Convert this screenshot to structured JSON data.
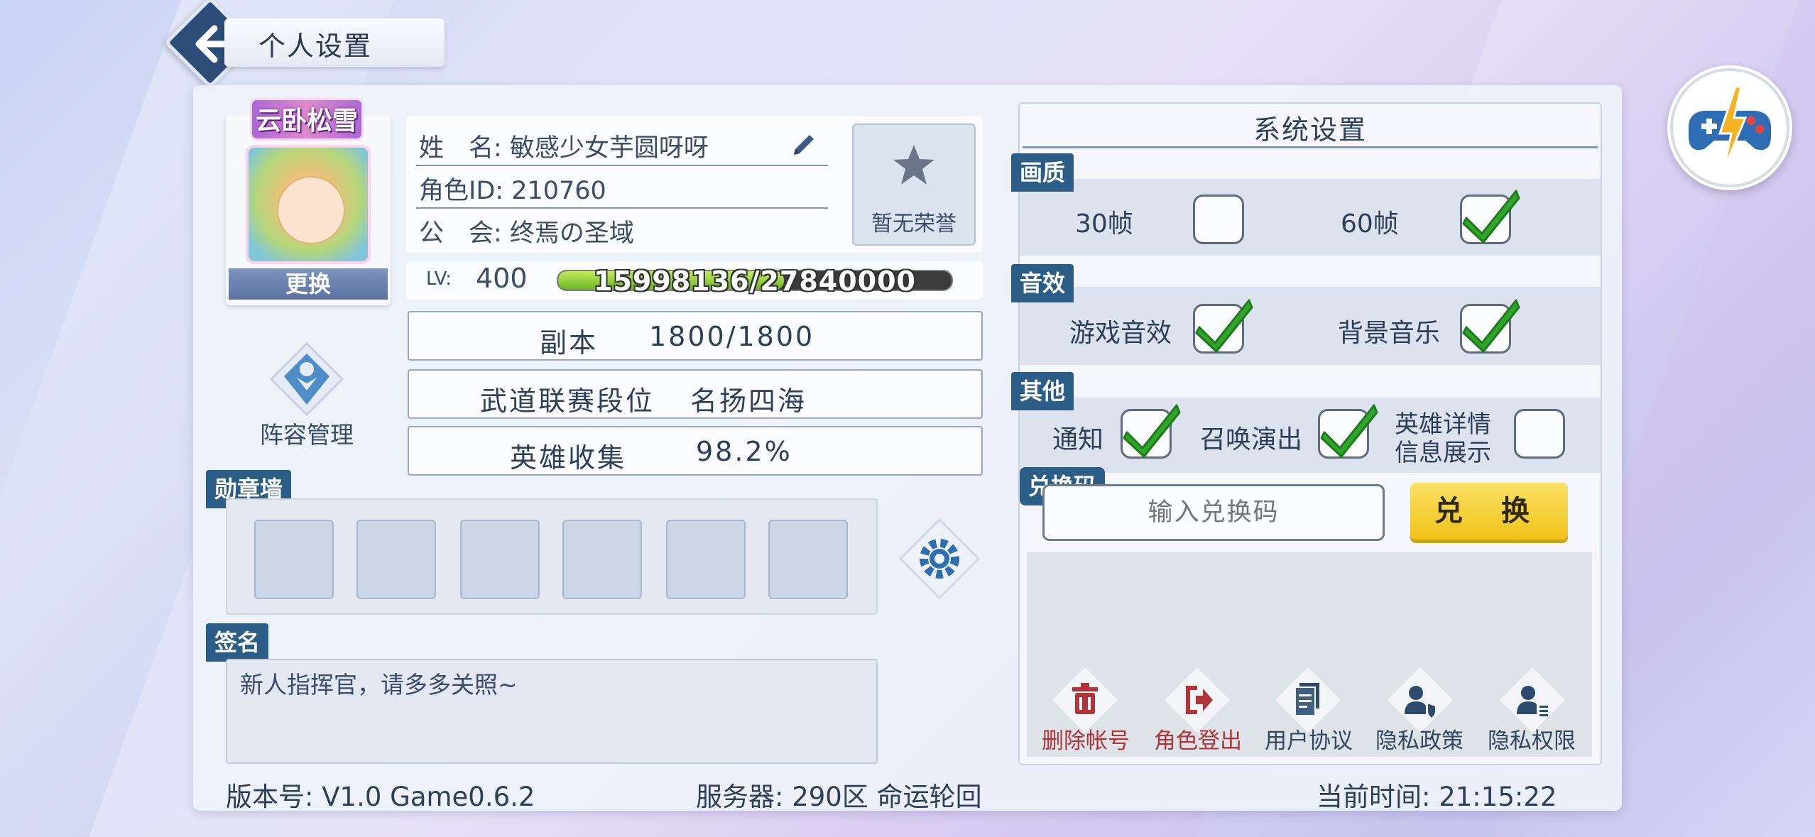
{
  "header": {
    "title": "个人设置"
  },
  "profile": {
    "avatar_badge": "云卧松雪",
    "change_label": "更换",
    "name_row": "姓　名: 敏感少女芋圆呀呀",
    "id_row": "角色ID: 210760",
    "guild_row": "公　会: 终焉の圣域",
    "honor_label": "暂无荣誉",
    "lv_label": "LV:",
    "lv_value": "400",
    "exp_text": "15998136/27840000",
    "exp_fraction": 0.5746
  },
  "stats": [
    {
      "label": "副本",
      "value": "1800/1800"
    },
    {
      "label": "武道联赛段位",
      "value": "名扬四海"
    },
    {
      "label": "英雄收集",
      "value": "98.2%"
    }
  ],
  "lineup_label": "阵容管理",
  "medal_wall": {
    "tab": "勋章墙"
  },
  "signature": {
    "tab": "签名",
    "text": "新人指挥官，请多多关照~"
  },
  "footer": {
    "version": "版本号: V1.0 Game0.6.2",
    "server": "服务器: 290区 命运轮回",
    "time": "当前时间: 21:15:22"
  },
  "system": {
    "title": "系统设置",
    "quality_tab": "画质",
    "fps30": {
      "label": "30帧",
      "checked": false
    },
    "fps60": {
      "label": "60帧",
      "checked": true
    },
    "sound_tab": "音效",
    "game_sound": {
      "label": "游戏音效",
      "checked": true
    },
    "bgm": {
      "label": "背景音乐",
      "checked": true
    },
    "other_tab": "其他",
    "notify": {
      "label": "通知",
      "checked": true
    },
    "summon": {
      "label": "召唤演出",
      "checked": true
    },
    "hero_detail": {
      "label1": "英雄详情",
      "label2": "信息展示",
      "checked": false
    },
    "code_tab": "兑换码",
    "code_placeholder": "输入兑换码",
    "redeem_label": "兑 换",
    "actions": [
      {
        "label": "删除帐号",
        "icon": "trash-icon"
      },
      {
        "label": "角色登出",
        "icon": "logout-icon"
      },
      {
        "label": "用户协议",
        "icon": "document-icon"
      },
      {
        "label": "隐私政策",
        "icon": "user-shield-icon"
      },
      {
        "label": "隐私权限",
        "icon": "user-list-icon"
      }
    ]
  },
  "colors": {
    "accent": "#2c5d86",
    "danger": "#b0353a",
    "check_green": "#2fa62a",
    "redeem_yellow": "#f0c21a"
  }
}
